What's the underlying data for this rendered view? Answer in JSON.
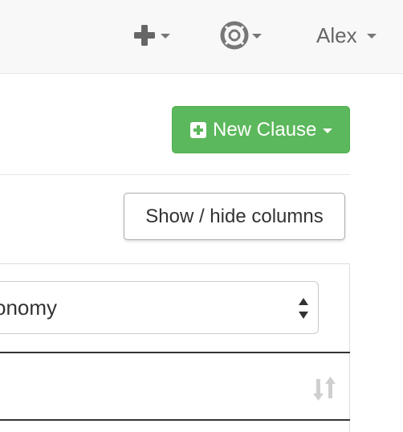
{
  "navbar": {
    "add_menu_icon": "plus-icon",
    "help_menu_icon": "life-ring-icon",
    "user_name": "Alex"
  },
  "toolbar": {
    "new_clause_label": "New Clause",
    "new_clause_icon": "plus-square-icon",
    "show_hide_columns_label": "Show / hide columns"
  },
  "table": {
    "filter_select_value": "onomy",
    "sort_icon": "sort-icon"
  },
  "colors": {
    "success": "#5cb85c",
    "navbar_bg": "#f8f8f8",
    "nav_text": "#777777"
  }
}
